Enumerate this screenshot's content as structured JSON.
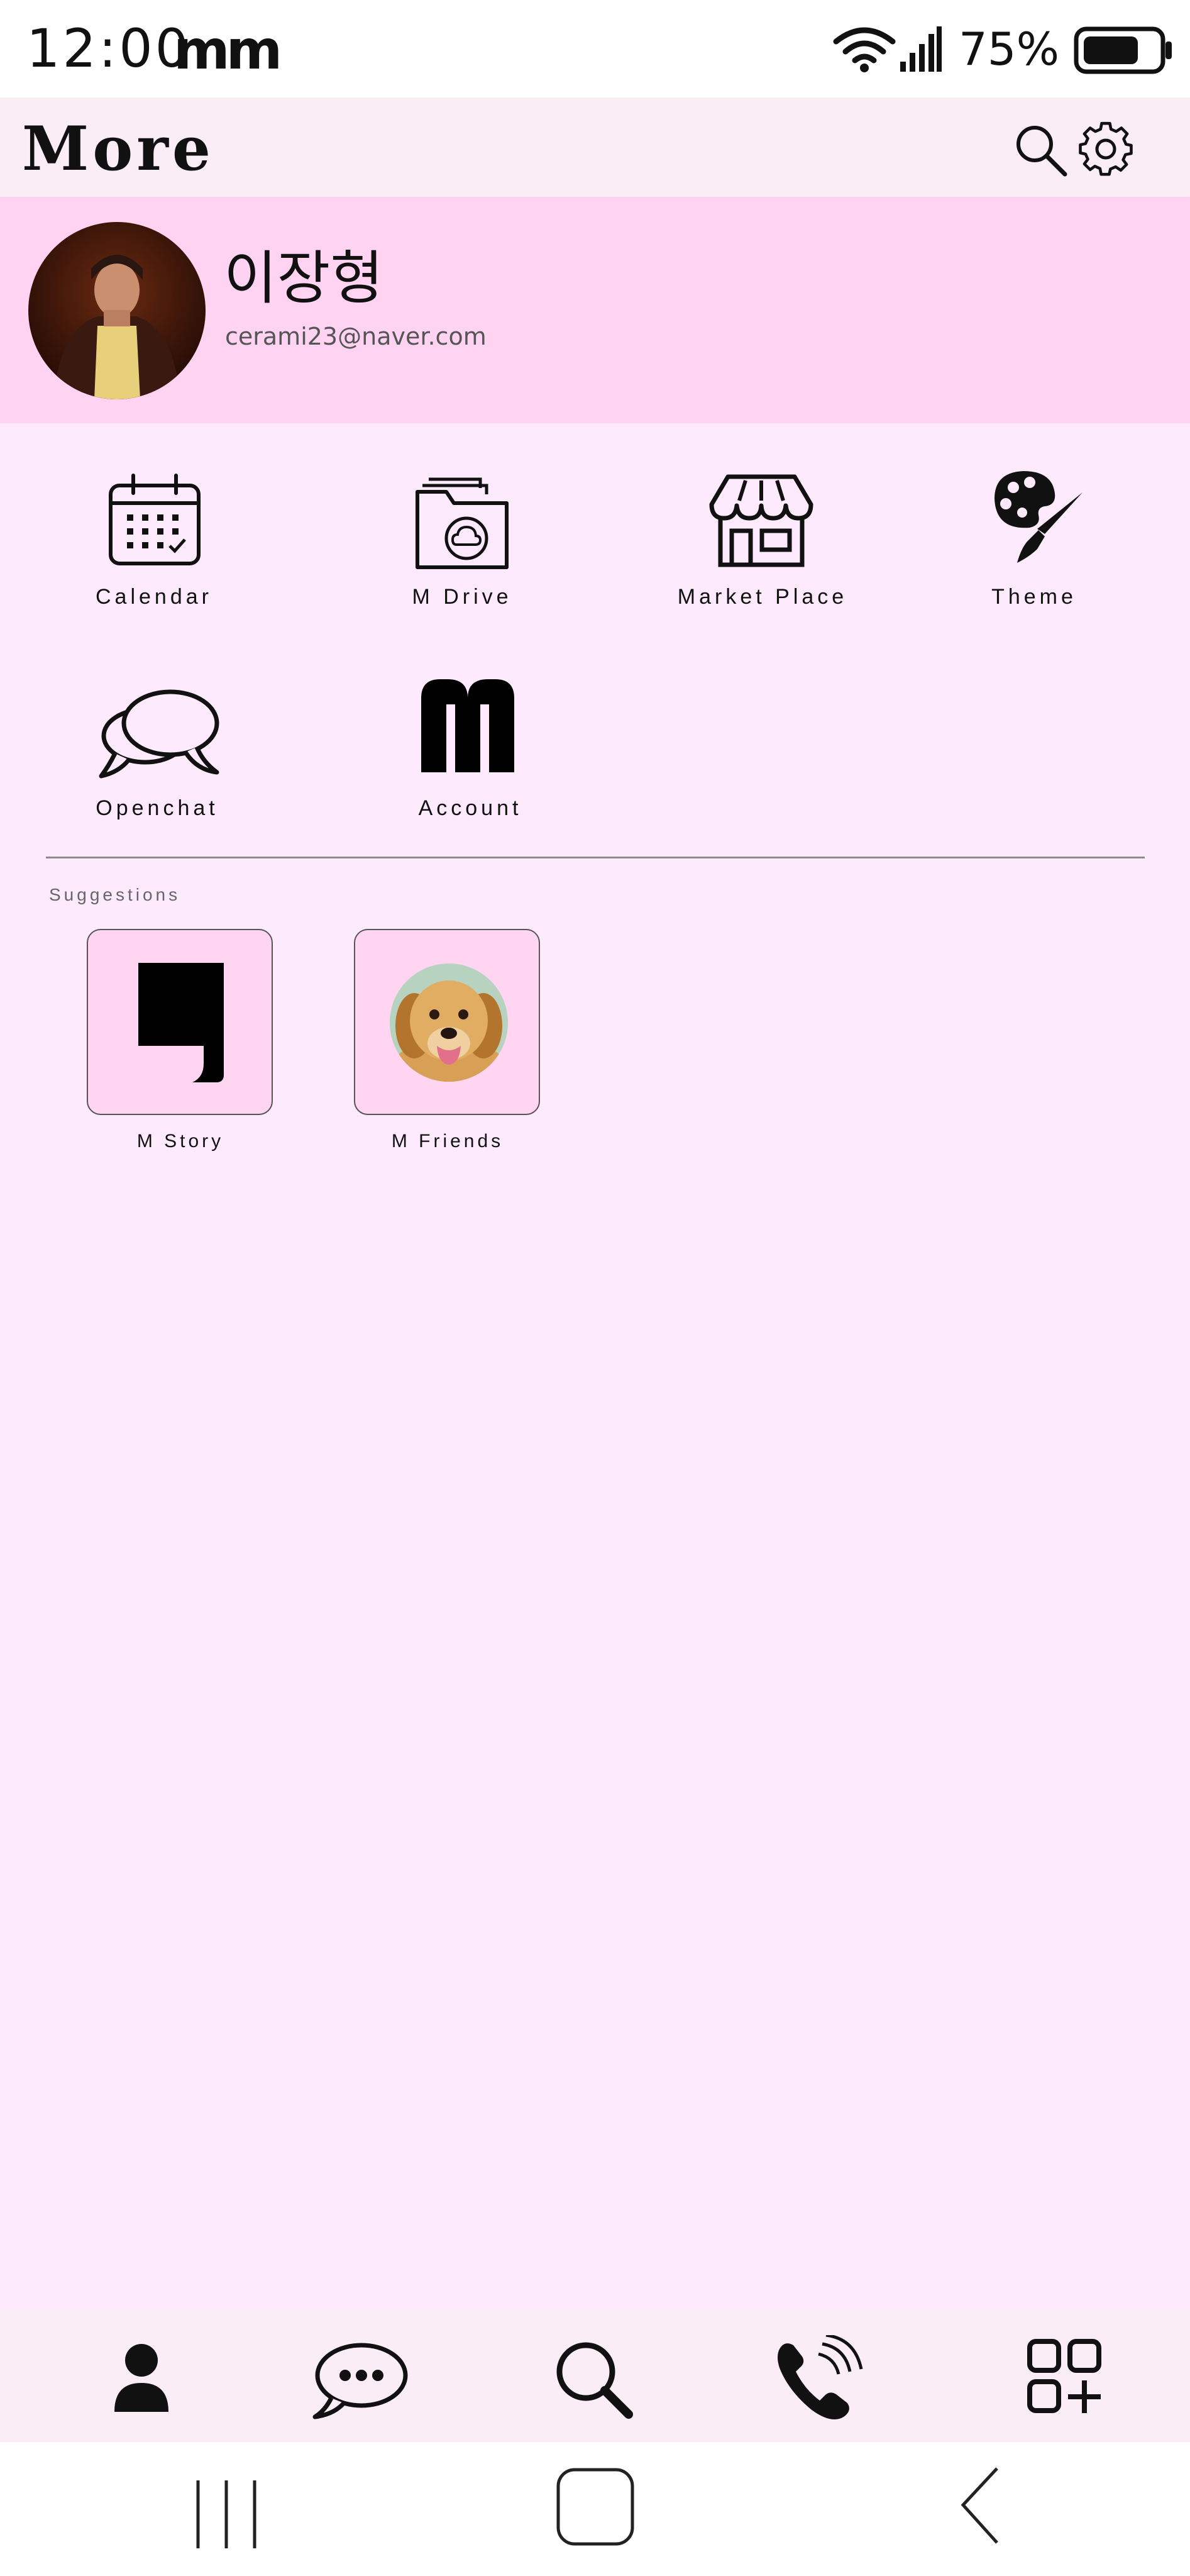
{
  "status_bar": {
    "time": "12:00",
    "app_badge": "mm",
    "battery_percent": "75%",
    "battery_level": 0.75,
    "wifi_icon": "wifi-icon",
    "signal_icon": "signal-icon"
  },
  "header": {
    "title": "More",
    "search_icon": "search-icon",
    "settings_icon": "gear-icon"
  },
  "profile": {
    "name": "이장형",
    "email": "cerami23@naver.com"
  },
  "menu": [
    {
      "label": "Calendar",
      "icon": "calendar-icon"
    },
    {
      "label": "M Drive",
      "icon": "cloud-folder-icon"
    },
    {
      "label": "Market Place",
      "icon": "store-icon"
    },
    {
      "label": "Theme",
      "icon": "palette-icon"
    },
    {
      "label": "Openchat",
      "icon": "chat-bubbles-icon"
    },
    {
      "label": "Account",
      "icon": "m-logo-icon"
    }
  ],
  "suggestions": {
    "title": "Suggestions",
    "items": [
      {
        "label": "M Story",
        "icon": "story-icon"
      },
      {
        "label": "M Friends",
        "icon": "puppy-avatar"
      }
    ]
  },
  "bottom_nav": [
    "person-icon",
    "chat-icon",
    "search-icon",
    "phone-icon",
    "apps-add-icon"
  ],
  "colors": {
    "background": "#fdeafc",
    "profile_bg": "#ffd3f1",
    "header_bg": "#fbedf6"
  }
}
